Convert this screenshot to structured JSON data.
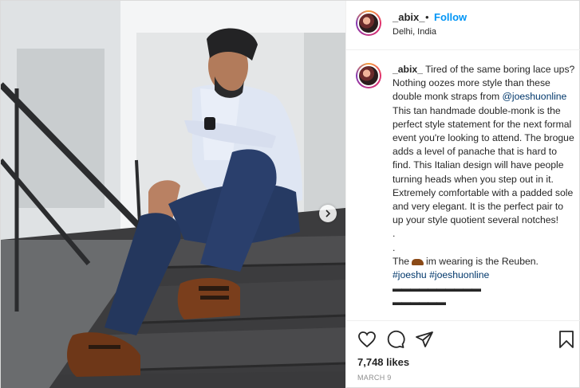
{
  "header": {
    "username": "_abix_",
    "separator": "•",
    "follow_label": "Follow",
    "location": "Delhi, India"
  },
  "caption": {
    "username": "_abix_",
    "text_1": " Tired of the same boring lace ups? Nothing oozes more style than these double monk straps from ",
    "mention": "@joeshuonline",
    "text_2": " This tan handmade double-monk is the perfect style statement for the next formal event you're looking to attend. The brogue adds a level of panache that is hard to find. This Italian design will have people turning heads when you step out in it. Extremely comfortable with a padded sole and very elegant. It is the perfect pair to up your style quotient several notches!",
    "dot_1": ".",
    "dot_2": ".",
    "line_pre_emoji": "The",
    "emoji_name": "mans-shoe-emoji",
    "line_post_emoji": "im wearing is the Reuben.",
    "tag_1": "#joeshu",
    "tag_2": "#joeshuonline",
    "dashes_1": "▬▬▬▬▬▬▬▬▬▬",
    "dashes_2": "▬▬▬▬▬▬"
  },
  "actions": {
    "icons": [
      "heart-icon",
      "comment-icon",
      "share-icon",
      "bookmark-icon"
    ],
    "likes": "7,748 likes",
    "date": "MARCH 9"
  },
  "photo": {
    "next_icon": "chevron-right-icon"
  },
  "colors": {
    "link": "#0095f6",
    "mention": "#00376b",
    "muted": "#8e8e8e"
  }
}
